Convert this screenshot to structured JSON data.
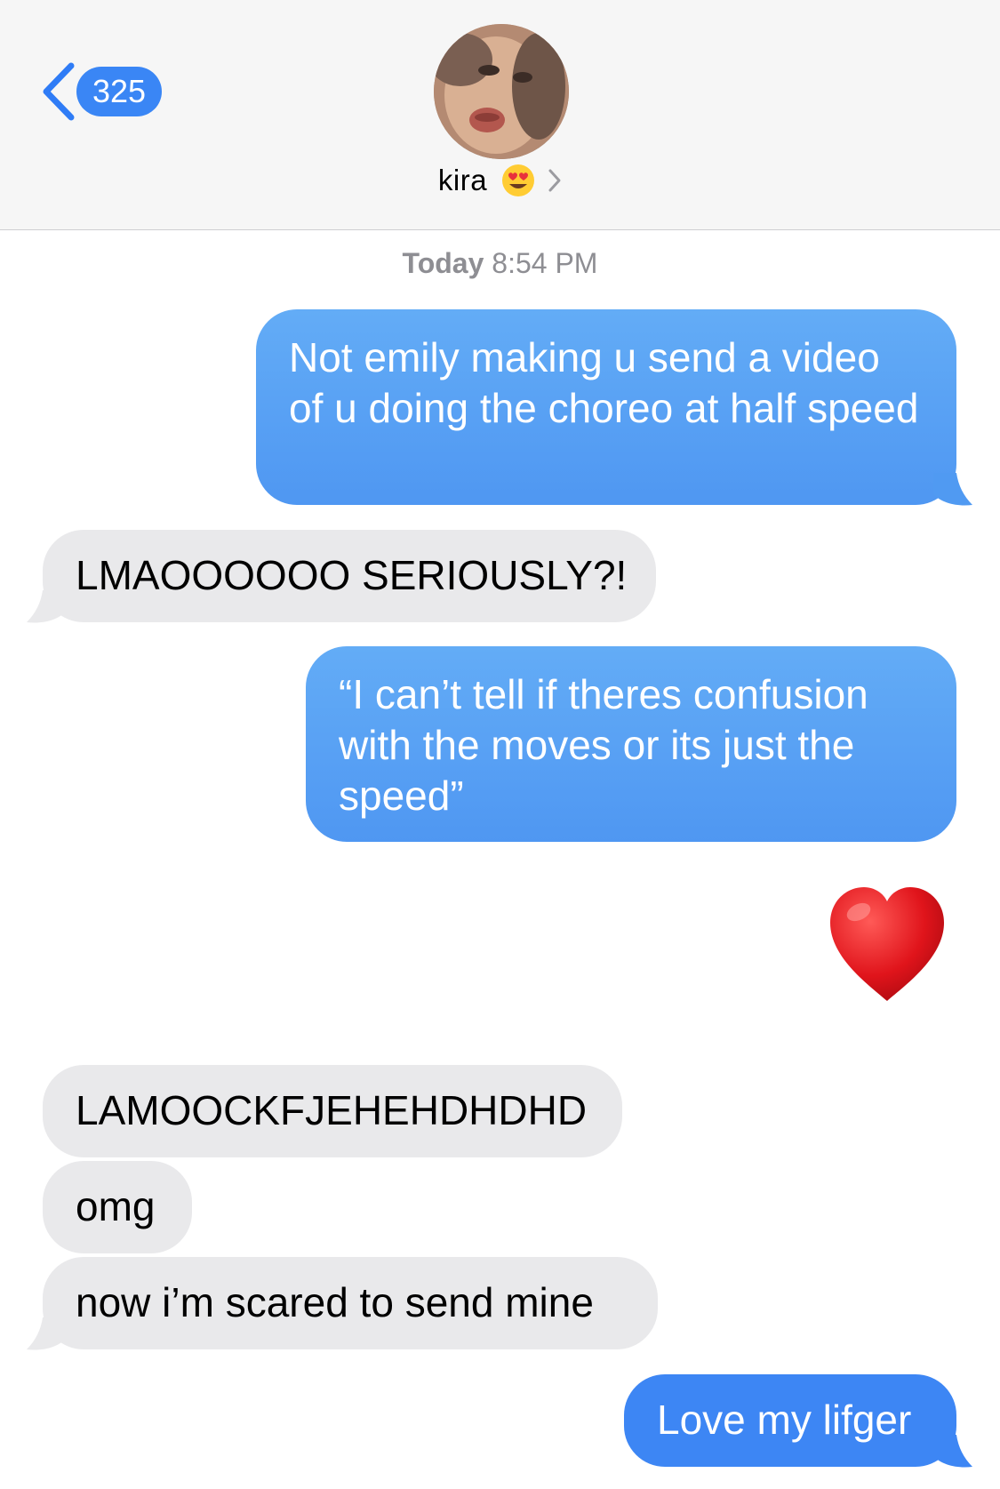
{
  "header": {
    "back_count": "325",
    "contact_name": "kira",
    "contact_emoji": "heart-eyes-emoji"
  },
  "conversation": {
    "timestamp_day": "Today",
    "timestamp_time": "8:54 PM",
    "messages": [
      {
        "direction": "sent",
        "text": "Not emily making u send a video of u doing the choreo at half speed"
      },
      {
        "direction": "received",
        "text": "LMAOOOOOO SERIOUSLY?!"
      },
      {
        "direction": "sent",
        "text": "“I can’t tell if theres confusion with the moves or its just the speed”"
      },
      {
        "direction": "sent",
        "emoji": "red-heart-emoji"
      },
      {
        "direction": "received",
        "text": "LAMOOCKFJEHEHDHDHD"
      },
      {
        "direction": "received",
        "text": "omg"
      },
      {
        "direction": "received",
        "text": "now i’m scared to send mine"
      },
      {
        "direction": "sent",
        "text": "Love my lifger"
      }
    ]
  },
  "colors": {
    "sent_bubble": "#4f97f2",
    "received_bubble": "#e9e9eb",
    "badge": "#3a86f5",
    "accent": "#2f7cf6"
  }
}
